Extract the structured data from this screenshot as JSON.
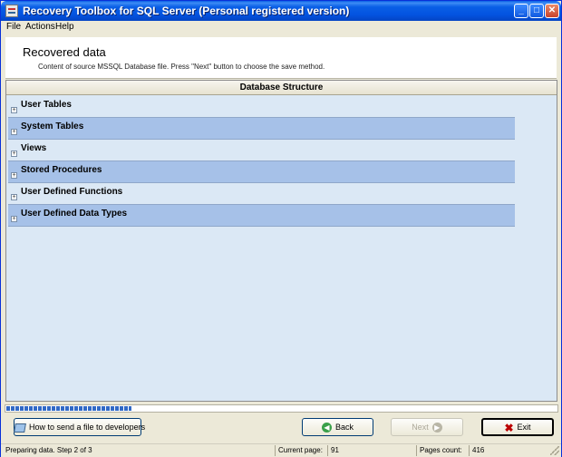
{
  "window": {
    "title": "Recovery Toolbox for SQL Server (Personal registered version)",
    "controls": {
      "minimize": "_",
      "maximize": "□",
      "close": "✕"
    }
  },
  "menu": [
    "File",
    "Actions",
    "Help"
  ],
  "header": {
    "title": "Recovered data",
    "description": "Content of source MSSQL Database file. Press \"Next\" button to choose the save method."
  },
  "grid": {
    "column_header": "Database Structure",
    "expander_glyph": "+",
    "rows": [
      {
        "label": "User Tables"
      },
      {
        "label": "System Tables"
      },
      {
        "label": "Views"
      },
      {
        "label": "Stored Procedures"
      },
      {
        "label": "User Defined Functions"
      },
      {
        "label": "User Defined Data Types"
      }
    ]
  },
  "progress": {
    "fraction": 0.228
  },
  "buttons": {
    "send": "How to send a file to developers",
    "back": "Back",
    "next": "Next",
    "exit": "Exit"
  },
  "icons": {
    "back": "left-arrow-icon",
    "next": "right-arrow-icon",
    "exit": "x-icon",
    "send": "envelope-icon"
  },
  "status": {
    "message": "Preparing data. Step 2 of 3",
    "current_page_label": "Current page:",
    "current_page": "91",
    "pages_count_label": "Pages count:",
    "pages_count": "416"
  },
  "colors": {
    "title_bar": "#0a5fe6",
    "row_odd": "#dbe8f5",
    "row_even": "#a6c1e8",
    "progress": "#3169c6"
  }
}
